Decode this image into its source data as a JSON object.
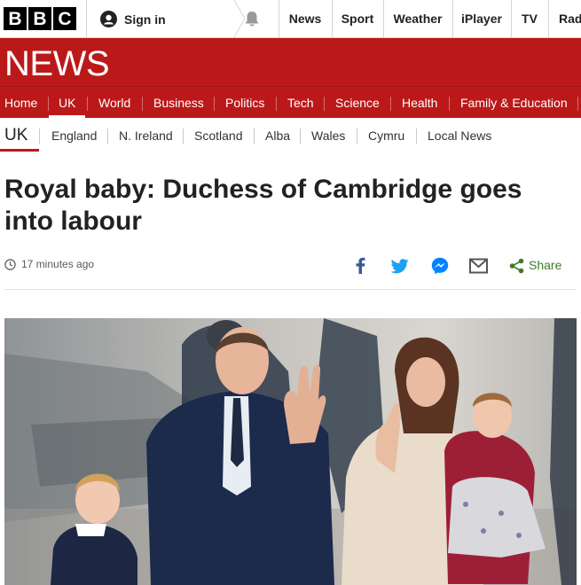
{
  "topbar": {
    "logo_letters": [
      "B",
      "B",
      "C"
    ],
    "sign_in": "Sign in",
    "nav": [
      "News",
      "Sport",
      "Weather",
      "iPlayer",
      "TV",
      "Rad"
    ],
    "icons": [
      "user-icon",
      "bell-icon"
    ]
  },
  "header": {
    "section_title": "NEWS",
    "brand_color": "#bb1919",
    "nav": [
      "Home",
      "UK",
      "World",
      "Business",
      "Politics",
      "Tech",
      "Science",
      "Health",
      "Family & Education"
    ],
    "active_nav": "UK"
  },
  "subnav": {
    "current": "UK",
    "items": [
      "England",
      "N. Ireland",
      "Scotland",
      "Alba",
      "Wales",
      "Cymru",
      "Local News"
    ]
  },
  "article": {
    "headline": "Royal baby: Duchess of Cambridge goes into labour",
    "timestamp": "17 minutes ago",
    "share_label": "Share",
    "share_icons": [
      "facebook-icon",
      "twitter-icon",
      "messenger-icon",
      "email-icon",
      "share-icon"
    ],
    "share_color": "#3e7d26"
  }
}
